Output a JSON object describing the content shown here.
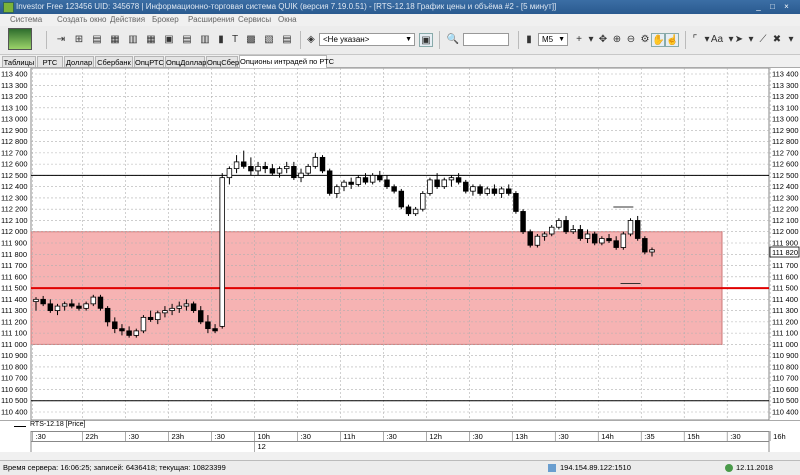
{
  "window": {
    "title": "Investor Free 123456 UID: 345678 | Информационно-торговая система QUIK (версия 7.19.0.51) - [RTS-12.18 График цены и объёма #2 - [5 минут]]",
    "buttons": [
      "_",
      "□",
      "×"
    ]
  },
  "menu": [
    "Система",
    "Создать окно",
    "Действия",
    "Брокер",
    "Расширения",
    "Сервисы",
    "Окна"
  ],
  "toolbar": {
    "account_combo": "<Не указан>",
    "interval_combo": "M5",
    "search_value": "",
    "zoom_label": "Aa"
  },
  "tabs": [
    {
      "label": "Таблицы",
      "active": false
    },
    {
      "label": "РТС",
      "active": false
    },
    {
      "label": "Доллар",
      "active": false
    },
    {
      "label": "Сбербанк",
      "active": false
    },
    {
      "label": "ОпцРТС",
      "active": false
    },
    {
      "label": "ОпцДоллар",
      "active": false
    },
    {
      "label": "ОпцСбер",
      "active": false
    },
    {
      "label": "Опционы интрадей по РТС",
      "active": true
    }
  ],
  "chart_data": {
    "type": "candlestick",
    "instrument": "RTS-12.18 [Price]",
    "timeframe": "5 минут",
    "ylim": [
      110400,
      113400
    ],
    "y_ticks": [
      "113 400",
      "113 300",
      "113 200",
      "113 100",
      "113 000",
      "112 900",
      "112 800",
      "112 700",
      "112 600",
      "112 500",
      "112 400",
      "112 300",
      "112 200",
      "112 100",
      "112 000",
      "111 900",
      "111 800",
      "111 700",
      "111 600",
      "111 500",
      "111 400",
      "111 300",
      "111 200",
      "111 100",
      "111 000",
      "110 900",
      "110 800",
      "110 700",
      "110 600",
      "110 500",
      "110 400"
    ],
    "y_values": [
      113400,
      113300,
      113200,
      113100,
      113000,
      112900,
      112800,
      112700,
      112600,
      112500,
      112400,
      112300,
      112200,
      112100,
      112000,
      111900,
      111800,
      111700,
      111600,
      111500,
      111400,
      111300,
      111200,
      111100,
      111000,
      110900,
      110800,
      110700,
      110600,
      110500,
      110400
    ],
    "last_price_label": "111 820",
    "last_price": 111820,
    "zone": {
      "from": 111000,
      "to": 112000,
      "color": "#f6b3b3",
      "border": "#c77"
    },
    "hlines": [
      {
        "value": 111500,
        "color": "#e00000",
        "width": 2
      },
      {
        "value": 112500,
        "color": "#000000",
        "width": 1
      },
      {
        "value": 110500,
        "color": "#000000",
        "width": 1
      }
    ],
    "marks": [
      {
        "value": 112220,
        "x_index": 82
      },
      {
        "value": 111540,
        "x_index": 83
      }
    ],
    "x_labels": [
      ":30",
      "22h",
      ":30",
      "23h",
      ":30",
      "10h",
      ":30",
      "11h",
      ":30",
      "12h",
      ":30",
      "13h",
      ":30",
      "14h",
      ":35",
      "15h",
      ":30",
      "16h"
    ],
    "x_label_index": [
      0,
      7,
      13,
      19,
      25,
      31,
      37,
      43,
      49,
      55,
      61,
      67,
      73,
      79,
      85,
      91,
      97,
      103
    ],
    "date_label": "12",
    "candles": [
      [
        111380,
        111420,
        111300,
        111400
      ],
      [
        111400,
        111430,
        111340,
        111360
      ],
      [
        111360,
        111400,
        111280,
        111300
      ],
      [
        111300,
        111360,
        111260,
        111340
      ],
      [
        111340,
        111380,
        111300,
        111360
      ],
      [
        111360,
        111400,
        111320,
        111340
      ],
      [
        111340,
        111370,
        111300,
        111320
      ],
      [
        111320,
        111380,
        111300,
        111360
      ],
      [
        111360,
        111440,
        111340,
        111420
      ],
      [
        111420,
        111440,
        111300,
        111320
      ],
      [
        111320,
        111340,
        111160,
        111200
      ],
      [
        111200,
        111240,
        111100,
        111140
      ],
      [
        111140,
        111180,
        111080,
        111120
      ],
      [
        111120,
        111160,
        111060,
        111080
      ],
      [
        111080,
        111140,
        111060,
        111120
      ],
      [
        111120,
        111260,
        111100,
        111240
      ],
      [
        111240,
        111300,
        111200,
        111220
      ],
      [
        111220,
        111300,
        111180,
        111280
      ],
      [
        111280,
        111340,
        111240,
        111300
      ],
      [
        111300,
        111360,
        111260,
        111320
      ],
      [
        111320,
        111380,
        111280,
        111340
      ],
      [
        111340,
        111400,
        111300,
        111360
      ],
      [
        111360,
        111380,
        111280,
        111300
      ],
      [
        111300,
        111340,
        111180,
        111200
      ],
      [
        111200,
        111260,
        111100,
        111140
      ],
      [
        111140,
        111180,
        111100,
        111120
      ],
      [
        111160,
        112520,
        111140,
        112480
      ],
      [
        112480,
        112580,
        112420,
        112560
      ],
      [
        112560,
        112680,
        112520,
        112620
      ],
      [
        112620,
        112720,
        112560,
        112580
      ],
      [
        112580,
        112660,
        112500,
        112540
      ],
      [
        112540,
        112620,
        112500,
        112580
      ],
      [
        112580,
        112620,
        112520,
        112560
      ],
      [
        112560,
        112600,
        112500,
        112520
      ],
      [
        112520,
        112580,
        112480,
        112560
      ],
      [
        112560,
        112620,
        112520,
        112580
      ],
      [
        112580,
        112620,
        112460,
        112480
      ],
      [
        112480,
        112560,
        112440,
        112520
      ],
      [
        112520,
        112600,
        112500,
        112580
      ],
      [
        112580,
        112700,
        112560,
        112660
      ],
      [
        112660,
        112680,
        112520,
        112540
      ],
      [
        112540,
        112560,
        112320,
        112340
      ],
      [
        112340,
        112420,
        112300,
        112400
      ],
      [
        112400,
        112460,
        112360,
        112440
      ],
      [
        112440,
        112480,
        112380,
        112420
      ],
      [
        112420,
        112500,
        112400,
        112480
      ],
      [
        112480,
        112520,
        112420,
        112440
      ],
      [
        112440,
        112520,
        112420,
        112500
      ],
      [
        112500,
        112540,
        112440,
        112460
      ],
      [
        112460,
        112500,
        112380,
        112400
      ],
      [
        112400,
        112420,
        112340,
        112360
      ],
      [
        112360,
        112380,
        112200,
        112220
      ],
      [
        112220,
        112240,
        112140,
        112160
      ],
      [
        112160,
        112220,
        112140,
        112200
      ],
      [
        112200,
        112360,
        112180,
        112340
      ],
      [
        112340,
        112480,
        112320,
        112460
      ],
      [
        112460,
        112520,
        112380,
        112400
      ],
      [
        112400,
        112480,
        112380,
        112460
      ],
      [
        112460,
        112500,
        112400,
        112480
      ],
      [
        112480,
        112520,
        112420,
        112440
      ],
      [
        112440,
        112460,
        112340,
        112360
      ],
      [
        112360,
        112420,
        112320,
        112400
      ],
      [
        112400,
        112420,
        112320,
        112340
      ],
      [
        112340,
        112400,
        112320,
        112380
      ],
      [
        112380,
        112420,
        112320,
        112340
      ],
      [
        112340,
        112400,
        112300,
        112380
      ],
      [
        112380,
        112420,
        112320,
        112340
      ],
      [
        112340,
        112360,
        112160,
        112180
      ],
      [
        112180,
        112200,
        111980,
        112000
      ],
      [
        112000,
        112020,
        111860,
        111880
      ],
      [
        111880,
        111980,
        111860,
        111960
      ],
      [
        111960,
        112000,
        111920,
        111980
      ],
      [
        111980,
        112060,
        111960,
        112040
      ],
      [
        112040,
        112120,
        112020,
        112100
      ],
      [
        112100,
        112140,
        111980,
        112000
      ],
      [
        112000,
        112060,
        111980,
        112020
      ],
      [
        112020,
        112060,
        111920,
        111940
      ],
      [
        111940,
        112020,
        111900,
        111980
      ],
      [
        111980,
        112000,
        111880,
        111900
      ],
      [
        111900,
        111960,
        111880,
        111940
      ],
      [
        111940,
        111980,
        111900,
        111920
      ],
      [
        111920,
        111960,
        111840,
        111860
      ],
      [
        111860,
        112000,
        111840,
        111980
      ],
      [
        111980,
        112120,
        111960,
        112100
      ],
      [
        112100,
        112140,
        111920,
        111940
      ],
      [
        111940,
        111960,
        111800,
        111820
      ],
      [
        111820,
        111860,
        111780,
        111840
      ]
    ]
  },
  "legend": {
    "series": "RTS-12.18 [Price]"
  },
  "status": {
    "server_time": "Время сервера: 16:06:25; записей: 6436418; текущая: 10823399",
    "connection": "194.154.89.122:1510",
    "date": "12.11.2018"
  }
}
